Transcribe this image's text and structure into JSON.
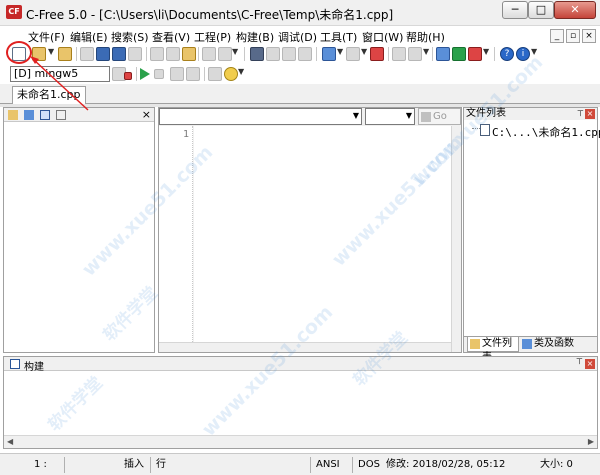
{
  "window": {
    "title": "C-Free 5.0 - [C:\\Users\\li\\Documents\\C-Free\\Temp\\未命名1.cpp]",
    "app_icon_label": "CF",
    "controls": [
      "─",
      "□",
      "✕"
    ]
  },
  "menu": {
    "items": [
      "文件(F)",
      "编辑(E)",
      "搜索(S)",
      "查看(V)",
      "工程(P)",
      "构建(B)",
      "调试(D)",
      "工具(T)",
      "窗口(W)",
      "帮助(H)"
    ],
    "mdi_controls": [
      "_",
      "▫",
      "×"
    ]
  },
  "toolbar": {
    "compiler_selected": "[D] mingw5"
  },
  "editor": {
    "tab_label": "未命名1.cpp",
    "go_label": "Go",
    "line_number": "1"
  },
  "left_panel": {
    "close": "×"
  },
  "file_list": {
    "title": "文件列表",
    "pin": "⊤",
    "close": "×",
    "entry": "C:\\...\\未命名1.cpp",
    "tabs": [
      "文件列表",
      "类及函数"
    ]
  },
  "build": {
    "title": "构建"
  },
  "status": {
    "line_col": "1 :",
    "insert": "插入",
    "row": "行",
    "encoding": "ANSI",
    "line_ending": "DOS",
    "modified": "修改: 2018/02/28, 05:12",
    "size": "大小: 0"
  },
  "watermark": {
    "text": "软件学堂",
    "url": "www.xue51.com"
  },
  "colors": {
    "annotation": "#e02020",
    "close_button": "#c5443a",
    "watermark": "#5096dc"
  }
}
